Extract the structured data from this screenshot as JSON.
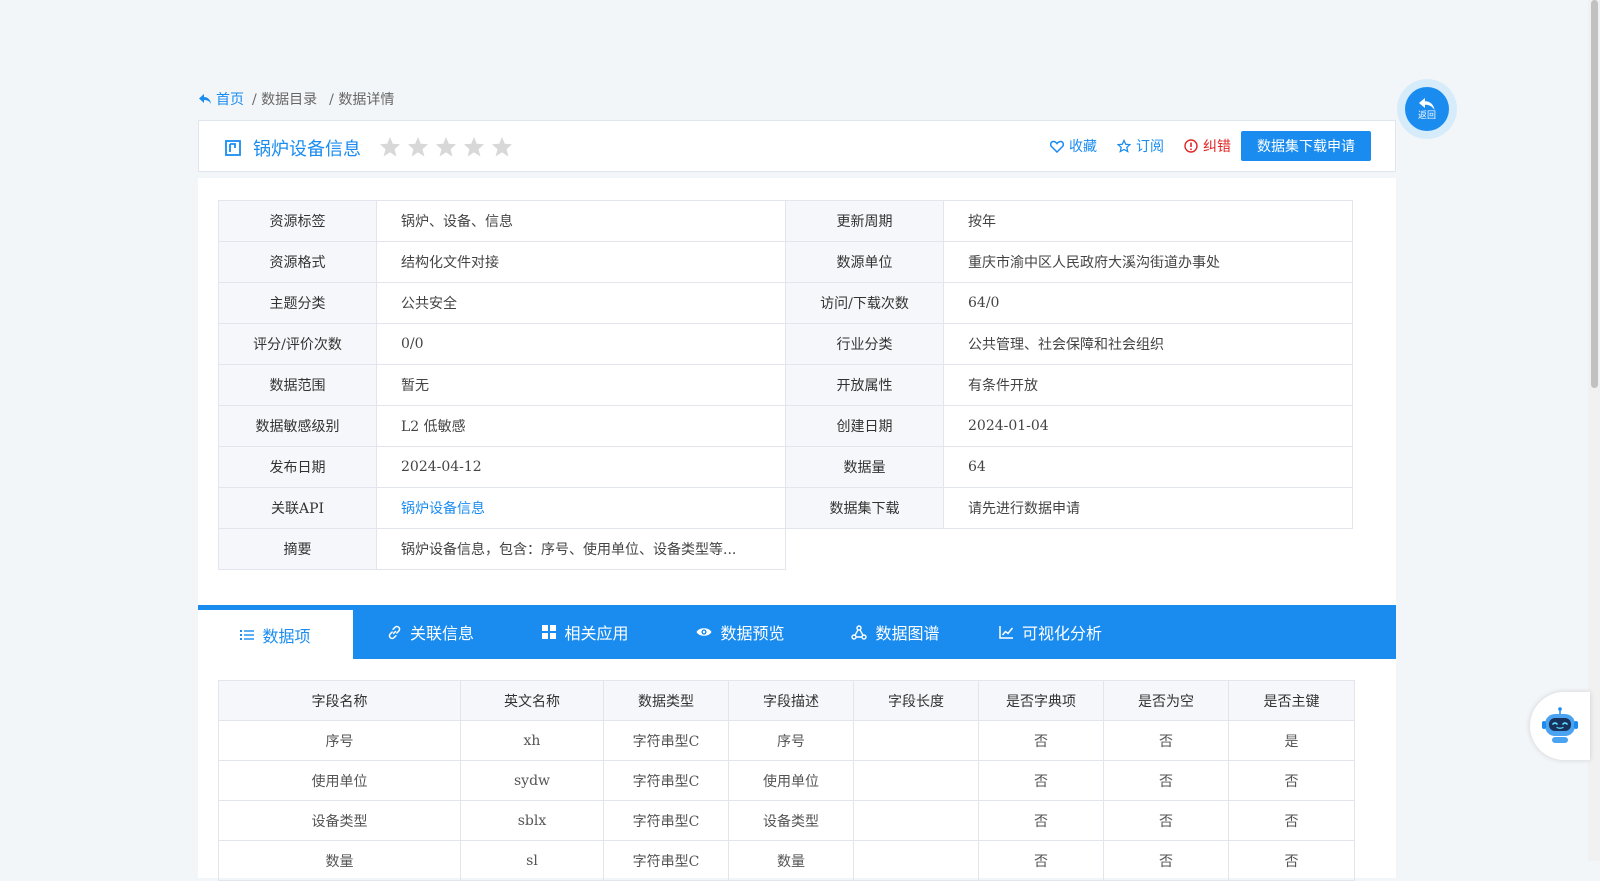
{
  "breadcrumb": {
    "home": "首页",
    "catalog": "/ 数据目录",
    "detail": "/ 数据详情"
  },
  "title": {
    "text": "锅炉设备信息",
    "rating": 0,
    "max_rating": 5
  },
  "actions": {
    "favorite": "收藏",
    "subscribe": "订阅",
    "report": "纠错",
    "apply": "数据集下载申请"
  },
  "info_rows": [
    {
      "l1": "资源标签",
      "v1": "锅炉、设备、信息",
      "l2": "更新周期",
      "v2": "按年"
    },
    {
      "l1": "资源格式",
      "v1": "结构化文件对接",
      "l2": "数源单位",
      "v2": "重庆市渝中区人民政府大溪沟街道办事处"
    },
    {
      "l1": "主题分类",
      "v1": "公共安全",
      "l2": "访问/下载次数",
      "v2": "64/0"
    },
    {
      "l1": "评分/评价次数",
      "v1": "0/0",
      "l2": "行业分类",
      "v2": "公共管理、社会保障和社会组织"
    },
    {
      "l1": "数据范围",
      "v1": "暂无",
      "l2": "开放属性",
      "v2": "有条件开放"
    },
    {
      "l1": "数据敏感级别",
      "v1": "L2 低敏感",
      "l2": "创建日期",
      "v2": "2024-01-04"
    },
    {
      "l1": "发布日期",
      "v1": "2024-04-12",
      "l2": "数据量",
      "v2": "64"
    },
    {
      "l1": "关联API",
      "v1": "锅炉设备信息",
      "l2": "数据集下载",
      "v2": "请先进行数据申请"
    },
    {
      "l1": "摘要",
      "v1": "锅炉设备信息，包含：序号、使用单位、设备类型等..."
    }
  ],
  "tabs": [
    "数据项",
    "关联信息",
    "相关应用",
    "数据预览",
    "数据图谱",
    "可视化分析"
  ],
  "fields_table": {
    "headers": [
      "字段名称",
      "英文名称",
      "数据类型",
      "字段描述",
      "字段长度",
      "是否字典项",
      "是否为空",
      "是否主键"
    ],
    "rows": [
      [
        "序号",
        "xh",
        "字符串型C",
        "序号",
        "",
        "否",
        "否",
        "是"
      ],
      [
        "使用单位",
        "sydw",
        "字符串型C",
        "使用单位",
        "",
        "否",
        "否",
        "否"
      ],
      [
        "设备类型",
        "sblx",
        "字符串型C",
        "设备类型",
        "",
        "否",
        "否",
        "否"
      ],
      [
        "数量",
        "sl",
        "字符串型C",
        "数量",
        "",
        "否",
        "否",
        "否"
      ]
    ]
  },
  "back_button": {
    "label": "返回"
  },
  "colors": {
    "accent": "#1a8cf0",
    "danger": "#e02424",
    "star": "#d8d8d8"
  }
}
